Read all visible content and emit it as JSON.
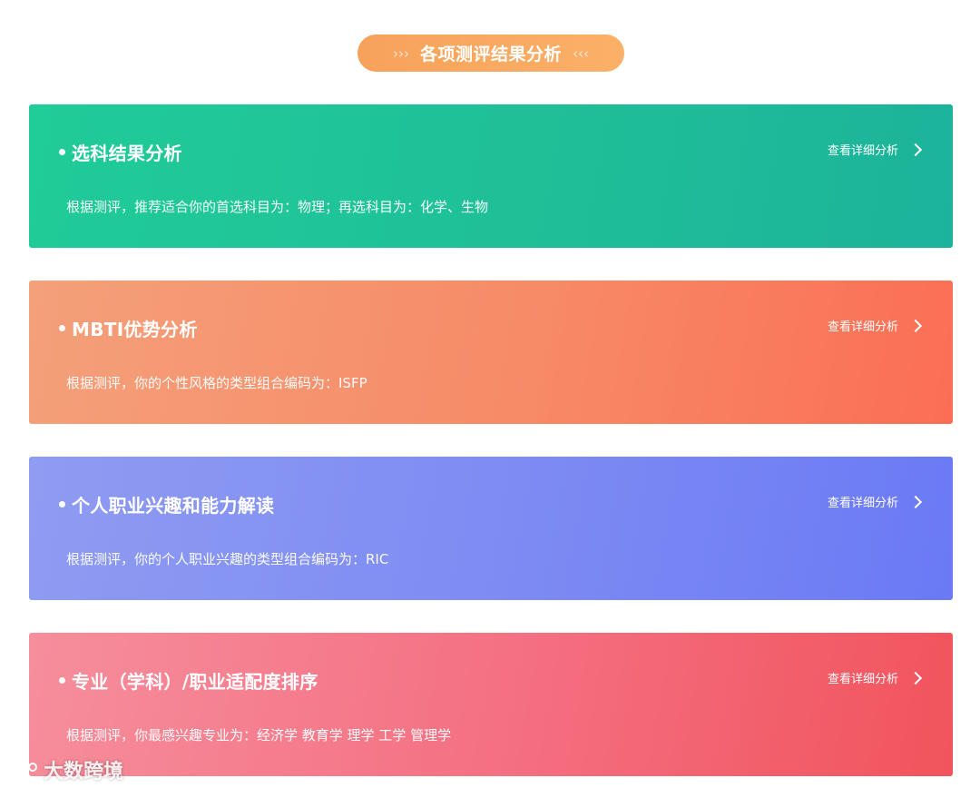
{
  "header": {
    "left_deco": "›››",
    "title": "各项测评结果分析",
    "right_deco": "‹‹‹"
  },
  "cards": [
    {
      "title": "选科结果分析",
      "link_label": "查看详细分析",
      "description": "根据测评，推荐适合你的首选科目为：物理；再选科目为：化学、生物"
    },
    {
      "title": "MBTI优势分析",
      "link_label": "查看详细分析",
      "description": "根据测评，你的个性风格的类型组合编码为：ISFP"
    },
    {
      "title": "个人职业兴趣和能力解读",
      "link_label": "查看详细分析",
      "description": "根据测评，你的个人职业兴趣的类型组合编码为：RIC"
    },
    {
      "title": "专业（学科）/职业适配度排序",
      "link_label": "查看详细分析",
      "description": "根据测评，你最感兴趣专业为：经济学 教育学 理学 工学 管理学"
    }
  ],
  "watermark": {
    "text": "大数跨境"
  },
  "colors": {
    "header": "#f9a862",
    "card_1": "#1fbf98",
    "card_2": "#f78a67",
    "card_3": "#7d8af3",
    "card_4": "#f46e80"
  }
}
